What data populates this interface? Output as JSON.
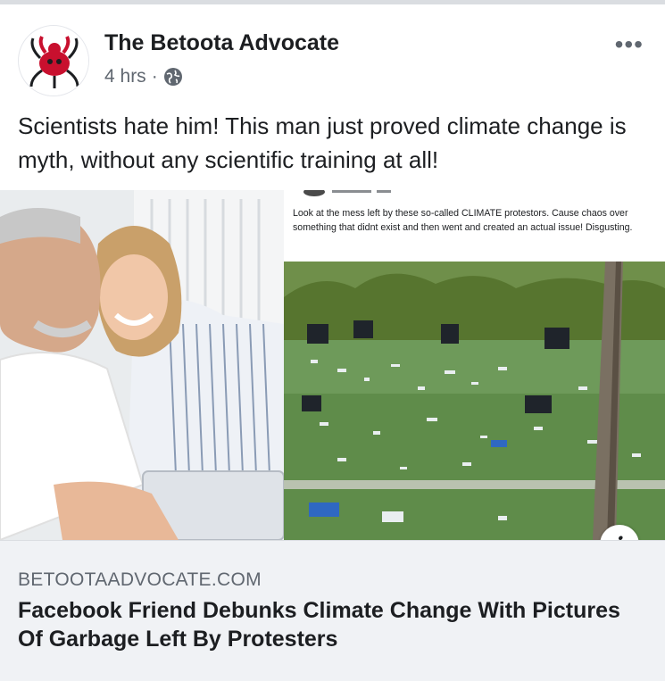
{
  "post": {
    "page_name": "The Betoota Advocate",
    "timestamp": "4 hrs",
    "separator": "·",
    "privacy_icon": "globe-icon",
    "more_label": "•••",
    "text": "Scientists hate him! This man just proved climate change is myth, without any scientific training at all!"
  },
  "image": {
    "embedded_caption": "Look at the mess left by these so-called CLIMATE protestors. Cause chaos over something that didnt exist and then went and created an actual issue! Disgusting."
  },
  "link_preview": {
    "info_label": "i",
    "domain": "BETOOTAADVOCATE.COM",
    "headline": "Facebook Friend Debunks Climate Change With Pictures Of Garbage Left By Protesters"
  },
  "colors": {
    "text_primary": "#1c1e21",
    "text_secondary": "#606770",
    "card_background": "#f0f2f5",
    "logo_red": "#c8102e"
  }
}
